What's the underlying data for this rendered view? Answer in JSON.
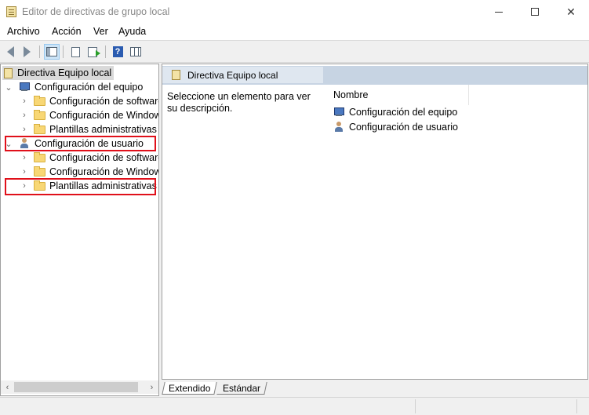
{
  "window": {
    "title": "Editor de directivas de grupo local"
  },
  "menu": [
    "Archivo",
    "Acción",
    "Ver",
    "Ayuda"
  ],
  "toolbar": {
    "buttons": [
      "back-icon",
      "forward-icon",
      "show-hide-tree-icon",
      "properties-icon",
      "export-list-icon",
      "help-icon",
      "extended-view-icon"
    ]
  },
  "tree": {
    "root": "Directiva Equipo local",
    "computer": {
      "label": "Configuración del equipo",
      "children": [
        "Configuración de software",
        "Configuración de Windows",
        "Plantillas administrativas"
      ]
    },
    "user": {
      "label": "Configuración de usuario",
      "children": [
        "Configuración de software",
        "Configuración de Windows",
        "Plantillas administrativas"
      ]
    }
  },
  "right_pane": {
    "header": "Directiva Equipo local",
    "description": "Seleccione un elemento para ver su descripción.",
    "column_header": "Nombre",
    "items": [
      "Configuración del equipo",
      "Configuración de usuario"
    ]
  },
  "tabs": [
    "Extendido",
    "Estándar"
  ],
  "colors": {
    "highlight": "#e0101a",
    "selection": "#d9d9d9",
    "header_bg": "#c7d4e3"
  }
}
